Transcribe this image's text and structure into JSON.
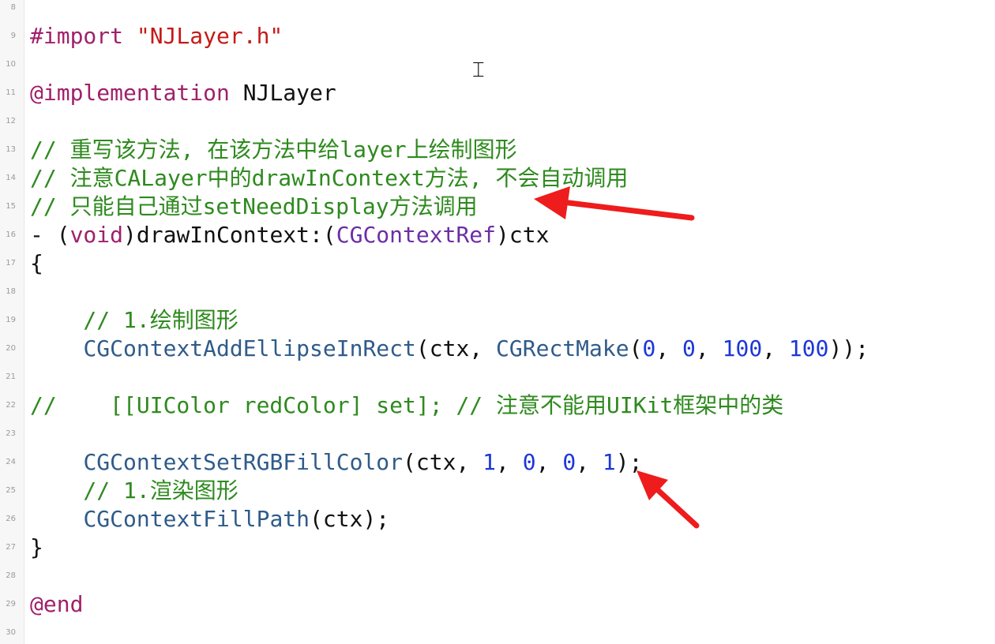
{
  "editor": {
    "line_numbers": [
      "8",
      "9",
      "10",
      "11",
      "12",
      "13",
      "14",
      "15",
      "16",
      "17",
      "18",
      "19",
      "20",
      "21",
      "22",
      "23",
      "24",
      "25",
      "26",
      "27",
      "28",
      "29",
      "30"
    ],
    "lines": [
      {
        "tokens": []
      },
      {
        "tokens": [
          {
            "t": "#import ",
            "c": "directive"
          },
          {
            "t": "\"NJLayer.h\"",
            "c": "string"
          }
        ]
      },
      {
        "tokens": []
      },
      {
        "tokens": [
          {
            "t": "@implementation",
            "c": "at"
          },
          {
            "t": " NJLayer",
            "c": "plain"
          }
        ]
      },
      {
        "tokens": []
      },
      {
        "tokens": [
          {
            "t": "// 重写该方法, 在该方法中给layer上绘制图形",
            "c": "comment"
          }
        ]
      },
      {
        "tokens": [
          {
            "t": "// 注意CALayer中的drawInContext方法, 不会自动调用",
            "c": "comment"
          }
        ]
      },
      {
        "tokens": [
          {
            "t": "// 只能自己通过setNeedDisplay方法调用",
            "c": "comment"
          }
        ]
      },
      {
        "tokens": [
          {
            "t": "- (",
            "c": "plain"
          },
          {
            "t": "void",
            "c": "keyword"
          },
          {
            "t": ")drawInContext:(",
            "c": "plain"
          },
          {
            "t": "CGContextRef",
            "c": "type"
          },
          {
            "t": ")ctx",
            "c": "plain"
          }
        ]
      },
      {
        "tokens": [
          {
            "t": "{",
            "c": "plain"
          }
        ]
      },
      {
        "tokens": []
      },
      {
        "tokens": [
          {
            "t": "    // 1.绘制图形",
            "c": "comment"
          }
        ]
      },
      {
        "tokens": [
          {
            "t": "    ",
            "c": "plain"
          },
          {
            "t": "CGContextAddEllipseInRect",
            "c": "func"
          },
          {
            "t": "(ctx, ",
            "c": "plain"
          },
          {
            "t": "CGRectMake",
            "c": "func"
          },
          {
            "t": "(",
            "c": "plain"
          },
          {
            "t": "0",
            "c": "number"
          },
          {
            "t": ", ",
            "c": "plain"
          },
          {
            "t": "0",
            "c": "number"
          },
          {
            "t": ", ",
            "c": "plain"
          },
          {
            "t": "100",
            "c": "number"
          },
          {
            "t": ", ",
            "c": "plain"
          },
          {
            "t": "100",
            "c": "number"
          },
          {
            "t": "));",
            "c": "plain"
          }
        ]
      },
      {
        "tokens": []
      },
      {
        "tokens": [
          {
            "t": "//    [[UIColor redColor] set]; // 注意不能用UIKit框架中的类",
            "c": "comment"
          }
        ]
      },
      {
        "tokens": []
      },
      {
        "tokens": [
          {
            "t": "    ",
            "c": "plain"
          },
          {
            "t": "CGContextSetRGBFillColor",
            "c": "func"
          },
          {
            "t": "(ctx, ",
            "c": "plain"
          },
          {
            "t": "1",
            "c": "number"
          },
          {
            "t": ", ",
            "c": "plain"
          },
          {
            "t": "0",
            "c": "number"
          },
          {
            "t": ", ",
            "c": "plain"
          },
          {
            "t": "0",
            "c": "number"
          },
          {
            "t": ", ",
            "c": "plain"
          },
          {
            "t": "1",
            "c": "number"
          },
          {
            "t": ");",
            "c": "plain"
          }
        ]
      },
      {
        "tokens": [
          {
            "t": "    // 1.渲染图形",
            "c": "comment"
          }
        ]
      },
      {
        "tokens": [
          {
            "t": "    ",
            "c": "plain"
          },
          {
            "t": "CGContextFillPath",
            "c": "func"
          },
          {
            "t": "(ctx);",
            "c": "plain"
          }
        ]
      },
      {
        "tokens": [
          {
            "t": "}",
            "c": "plain"
          }
        ]
      },
      {
        "tokens": []
      },
      {
        "tokens": [
          {
            "t": "@end",
            "c": "at"
          }
        ]
      },
      {
        "tokens": []
      }
    ]
  },
  "annotations": {
    "arrow_color": "#ee1c1c"
  },
  "cursor": {
    "icon": "ibeam-cursor-icon"
  }
}
